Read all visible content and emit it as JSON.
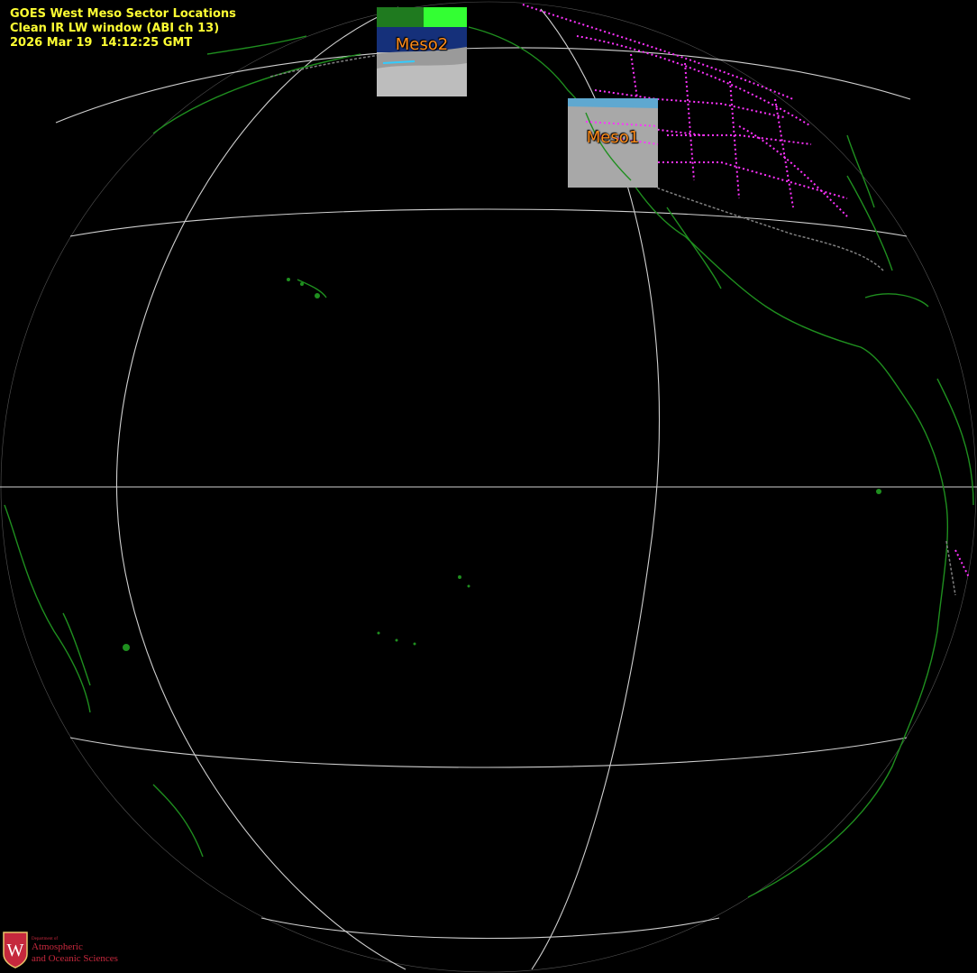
{
  "header": {
    "title": "GOES West Meso Sector Locations",
    "channel": "Clean IR LW window (ABI ch 13)",
    "timestamp": "2026 Mar 19  14:12:25 GMT"
  },
  "sectors": [
    {
      "label": "Meso2"
    },
    {
      "label": "Meso1"
    }
  ],
  "logo": {
    "small_text": "Department of",
    "line1": "Atmospheric",
    "line2": "and Oceanic Sciences",
    "emblem_letter": "W"
  },
  "colors": {
    "background": "#000000",
    "header_text": "#ffff33",
    "coastline": "#1f8f1f",
    "state_borders": "#ff33ff",
    "country_borders": "#808080",
    "graticule": "#d0d0d0",
    "sector_label": "#ff8c1a",
    "logo": "#c5283d"
  }
}
